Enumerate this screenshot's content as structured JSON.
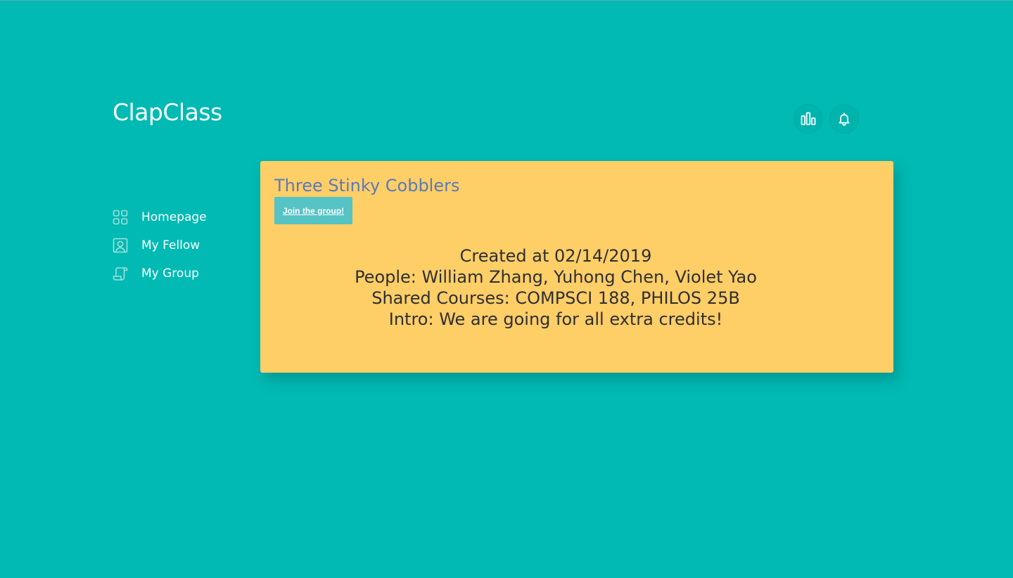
{
  "app": {
    "title": "ClapClass"
  },
  "header": {
    "actions": [
      {
        "name": "stats",
        "icon": "bar-chart-icon"
      },
      {
        "name": "notifications",
        "icon": "bell-icon"
      }
    ]
  },
  "sidebar": {
    "items": [
      {
        "label": "Homepage",
        "icon": "grid-icon"
      },
      {
        "label": "My Fellow",
        "icon": "person-icon"
      },
      {
        "label": "My Group",
        "icon": "scroll-icon"
      }
    ]
  },
  "group": {
    "name": "Three Stinky Cobblers",
    "join_label": "Join the group!",
    "created": "Created at 02/14/2019",
    "people": "People: William Zhang, Yuhong Chen, Violet Yao",
    "courses": "Shared Courses: COMPSCI 188, PHILOS 25B",
    "intro": "Intro: We are going for all extra credits!"
  },
  "colors": {
    "background": "#00BAB3",
    "card": "#FECE67",
    "group_name": "#5D7AB7",
    "join_button": "#56C3C5",
    "detail_text": "#2F2F33"
  }
}
